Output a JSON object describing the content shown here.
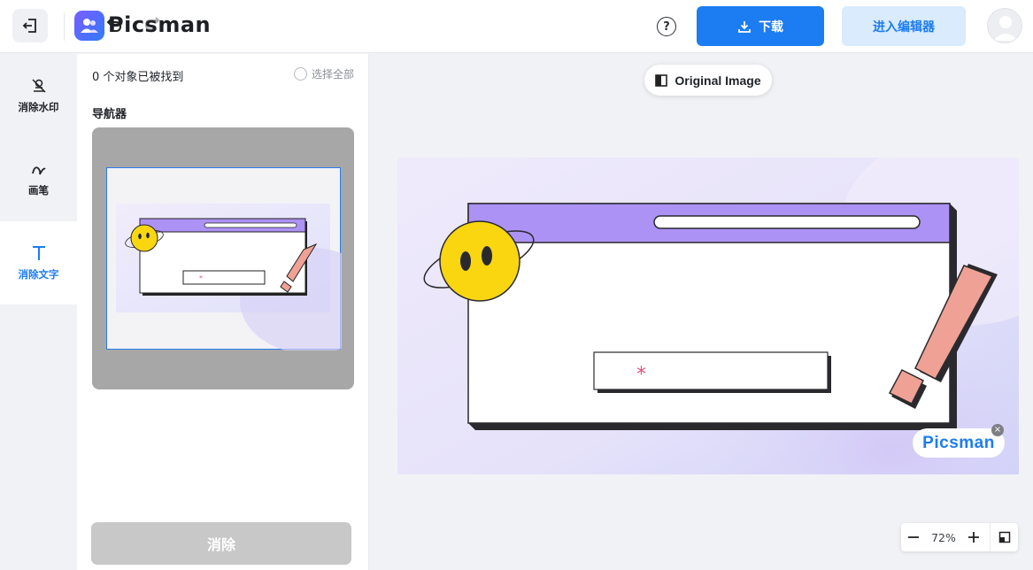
{
  "header": {
    "app_name": "Picsman",
    "help_symbol": "?",
    "download_label": "下载",
    "editor_label": "进入编辑器",
    "icons": [
      "exit-icon",
      "logo-icon",
      "undo-icon",
      "redo-icon",
      "help-icon",
      "download-icon",
      "avatar-icon"
    ]
  },
  "rail": {
    "items": [
      {
        "label": "消除水印",
        "icon": "watermark-remove-icon",
        "active": false
      },
      {
        "label": "画笔",
        "icon": "brush-icon",
        "active": false
      },
      {
        "label": "消除文字",
        "icon": "text-remove-icon",
        "active": true
      }
    ]
  },
  "panel": {
    "found_text": "0 个对象已被找到",
    "select_all_label": "选择全部",
    "navigator_title": "导航器",
    "erase_label": "消除"
  },
  "canvas": {
    "original_label": "Original Image",
    "watermark_text": "Picsman",
    "watermark_close": "×",
    "zoom_value": "72%"
  },
  "colors": {
    "accent": "#1c7cf2",
    "accent_light": "#d9ebfd",
    "disabled": "#c8c8c8",
    "window_bar": "#ad92f5",
    "emoji": "#f9d60f",
    "exclamation": "#efa195"
  }
}
